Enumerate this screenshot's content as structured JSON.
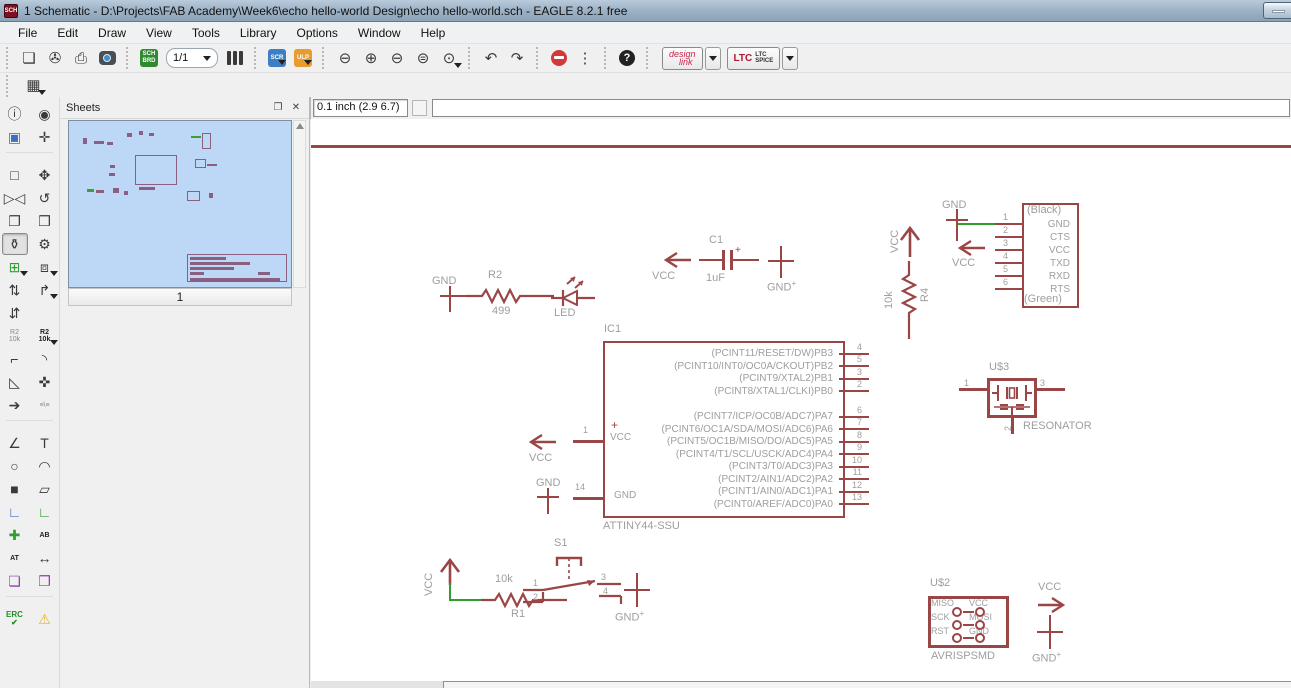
{
  "window": {
    "title": "1 Schematic - D:\\Projects\\FAB Academy\\Week6\\echo hello-world Design\\echo hello-world.sch - EAGLE 8.2.1 free",
    "app_icon": "SCH",
    "minimize": ""
  },
  "menu": [
    "File",
    "Edit",
    "Draw",
    "View",
    "Tools",
    "Library",
    "Options",
    "Window",
    "Help"
  ],
  "toolbar": {
    "sheet_selector": "1/1",
    "sch": "SCH",
    "brd": "BRD",
    "scr": "SCR",
    "ulp": "ULP",
    "design_line1": "design",
    "design_line2": "link",
    "ltc_logo": "LTC",
    "ltc_line1": "LTC",
    "ltc_line2": "SPICE",
    "help": "?"
  },
  "icons": {
    "open": "❏",
    "save": "✇",
    "print": "⎙",
    "library": "",
    "zoom_fit": "⊖",
    "zoom_in": "⊕",
    "zoom_out": "⊖",
    "zoom_redraw": "⊜",
    "zoom_select": "⊙",
    "undo": "↶",
    "redo": "↷",
    "dots": "⋮",
    "grid": "▦",
    "dock": "❐",
    "close": "✕",
    "info": "i"
  },
  "left_tools_g1": [
    {
      "name": "info-tool",
      "glyph": "ⓘ"
    },
    {
      "name": "show-tool",
      "glyph": "◉"
    },
    {
      "name": "display-layers-tool",
      "glyph": "▣",
      "cls": "c-blue"
    },
    {
      "name": "mark-tool",
      "glyph": "✛"
    }
  ],
  "left_tools_g2": [
    {
      "name": "group-tool",
      "glyph": "□"
    },
    {
      "name": "move-tool",
      "glyph": "✥"
    },
    {
      "name": "mirror-tool",
      "glyph": "▷◁"
    },
    {
      "name": "rotate-tool",
      "glyph": "↺"
    },
    {
      "name": "copy-tool",
      "glyph": "❐"
    },
    {
      "name": "paste-tool",
      "glyph": "❒"
    },
    {
      "name": "delete-tool",
      "glyph": "⚱",
      "selected": true
    },
    {
      "name": "change-tool",
      "glyph": "⚙"
    },
    {
      "name": "add-part-tool",
      "glyph": "⊞",
      "cls": "c-green",
      "dd": true
    },
    {
      "name": "invoke-tool",
      "glyph": "⧈",
      "dd": true
    },
    {
      "name": "pinswap-tool",
      "glyph": "⇅"
    },
    {
      "name": "replace-tool",
      "glyph": "↱",
      "dd": true
    },
    {
      "name": "gateswap-tool",
      "glyph": "⇵"
    },
    {
      "name": "blank",
      "glyph": ""
    },
    {
      "name": "name-tool",
      "glyph": "R2\n10k",
      "cls": "tiny"
    },
    {
      "name": "smash-tool",
      "glyph": "R2\n10k",
      "cls": "tinyb",
      "dd": true
    },
    {
      "name": "miter-tool",
      "glyph": "⌐"
    },
    {
      "name": "round-miter-tool",
      "glyph": "◝"
    },
    {
      "name": "split-tool",
      "glyph": "◺"
    },
    {
      "name": "optimize-tool",
      "glyph": "✜"
    },
    {
      "name": "route-tool",
      "glyph": "➔"
    },
    {
      "name": "meander-tool",
      "glyph": "≡\\≡",
      "cls": "tiny"
    }
  ],
  "left_tools_g3": [
    {
      "name": "wire-tool",
      "glyph": "∠"
    },
    {
      "name": "text-tool",
      "glyph": "T"
    },
    {
      "name": "circle-tool",
      "glyph": "○"
    },
    {
      "name": "arc-tool",
      "glyph": "◠"
    },
    {
      "name": "rect-tool",
      "glyph": "■"
    },
    {
      "name": "polygon-tool",
      "glyph": "▱"
    },
    {
      "name": "bus-tool",
      "glyph": "∟",
      "cls": "c-blue"
    },
    {
      "name": "net-tool",
      "glyph": "∟",
      "cls": "c-green"
    },
    {
      "name": "junction-tool",
      "glyph": "✚",
      "cls": "c-green"
    },
    {
      "name": "label-tool",
      "glyph": "AB",
      "cls": "tinyb"
    },
    {
      "name": "attribute-tool",
      "glyph": "AT",
      "cls": "tinyb"
    },
    {
      "name": "dimension-tool",
      "glyph": "↔"
    },
    {
      "name": "module-tool",
      "glyph": "❏",
      "cls": "c-purple"
    },
    {
      "name": "port-tool",
      "glyph": "❒",
      "cls": "c-purple"
    }
  ],
  "left_tools_g4": [
    {
      "name": "erc-tool",
      "glyph": "ERC\n✔",
      "cls": "erc"
    },
    {
      "name": "errors-tool",
      "glyph": "⚠",
      "cls": "c-yellow"
    }
  ],
  "sheets_panel": {
    "title": "Sheets",
    "sheet_label": "1"
  },
  "command_bar": {
    "coords": "0.1 inch (2.9 6.7)",
    "value": ""
  },
  "colors": {
    "symbol": "#9b4646",
    "net": "#2f9e2f",
    "label": "#9e9e9e"
  },
  "schematic": {
    "gnd1": {
      "label": "GND"
    },
    "r2": {
      "ref": "R2",
      "value": "499"
    },
    "led": {
      "label": "LED"
    },
    "c1": {
      "ref": "C1",
      "value": "1uF",
      "plus": "+",
      "vcc": "VCC",
      "gnd": "GND",
      "gnd_sup": "+"
    },
    "ic1": {
      "ref": "IC1",
      "value": "ATTINY44-SSU",
      "plus": "+",
      "pin1": "1",
      "pin14": "14",
      "vcc_inside": "VCC",
      "gnd_inside": "GND",
      "vcc_label": "VCC",
      "gnd_label": "GND",
      "right_pins_top": [
        {
          "num": "4",
          "label": "(PCINT11/RESET/DW)PB3"
        },
        {
          "num": "5",
          "label": "(PCINT10/INT0/OC0A/CKOUT)PB2"
        },
        {
          "num": "3",
          "label": "(PCINT9/XTAL2)PB1"
        },
        {
          "num": "2",
          "label": "(PCINT8/XTAL1/CLKI)PB0"
        }
      ],
      "right_pins_bottom": [
        {
          "num": "6",
          "label": "(PCINT7/ICP/OC0B/ADC7)PA7"
        },
        {
          "num": "7",
          "label": "(PCINT6/OC1A/SDA/MOSI/ADC6)PA6"
        },
        {
          "num": "8",
          "label": "(PCINT5/OC1B/MISO/DO/ADC5)PA5"
        },
        {
          "num": "9",
          "label": "(PCINT4/T1/SCL/USCK/ADC4)PA4"
        },
        {
          "num": "10",
          "label": "(PCINT3/T0/ADC3)PA3"
        },
        {
          "num": "11",
          "label": "(PCINT2/AIN1/ADC2)PA2"
        },
        {
          "num": "12",
          "label": "(PCINT1/AIN0/ADC1)PA1"
        },
        {
          "num": "13",
          "label": "(PCINT0/AREF/ADC0)PA0"
        }
      ]
    },
    "r4": {
      "ref": "R4",
      "value": "10k",
      "vcc": "VCC"
    },
    "ftdi": {
      "top": "(Black)",
      "bottom": "(Green)",
      "gnd": "GND",
      "vcc": "VCC",
      "pins": [
        {
          "num": "1",
          "name": "GND"
        },
        {
          "num": "2",
          "name": "CTS"
        },
        {
          "num": "3",
          "name": "VCC"
        },
        {
          "num": "4",
          "name": "TXD"
        },
        {
          "num": "5",
          "name": "RXD"
        },
        {
          "num": "6",
          "name": "RTS"
        }
      ]
    },
    "resonator": {
      "ref": "U$3",
      "value": "RESONATOR",
      "pin1": "1",
      "pin2": "2",
      "pin3": "3"
    },
    "r1": {
      "ref": "R1",
      "value": "10k",
      "vcc": "VCC"
    },
    "s1": {
      "ref": "S1",
      "pins": [
        "1",
        "2",
        "3",
        "4"
      ],
      "gnd": "GND",
      "gnd_sup": "+"
    },
    "isp": {
      "ref": "U$2",
      "value": "AVRISPSMD",
      "labels": [
        "MISO",
        "VCC",
        "SCK",
        "MOSI",
        "RST",
        "GND"
      ],
      "vcc": "VCC",
      "gnd": "GND",
      "gnd_sup": "+"
    }
  }
}
